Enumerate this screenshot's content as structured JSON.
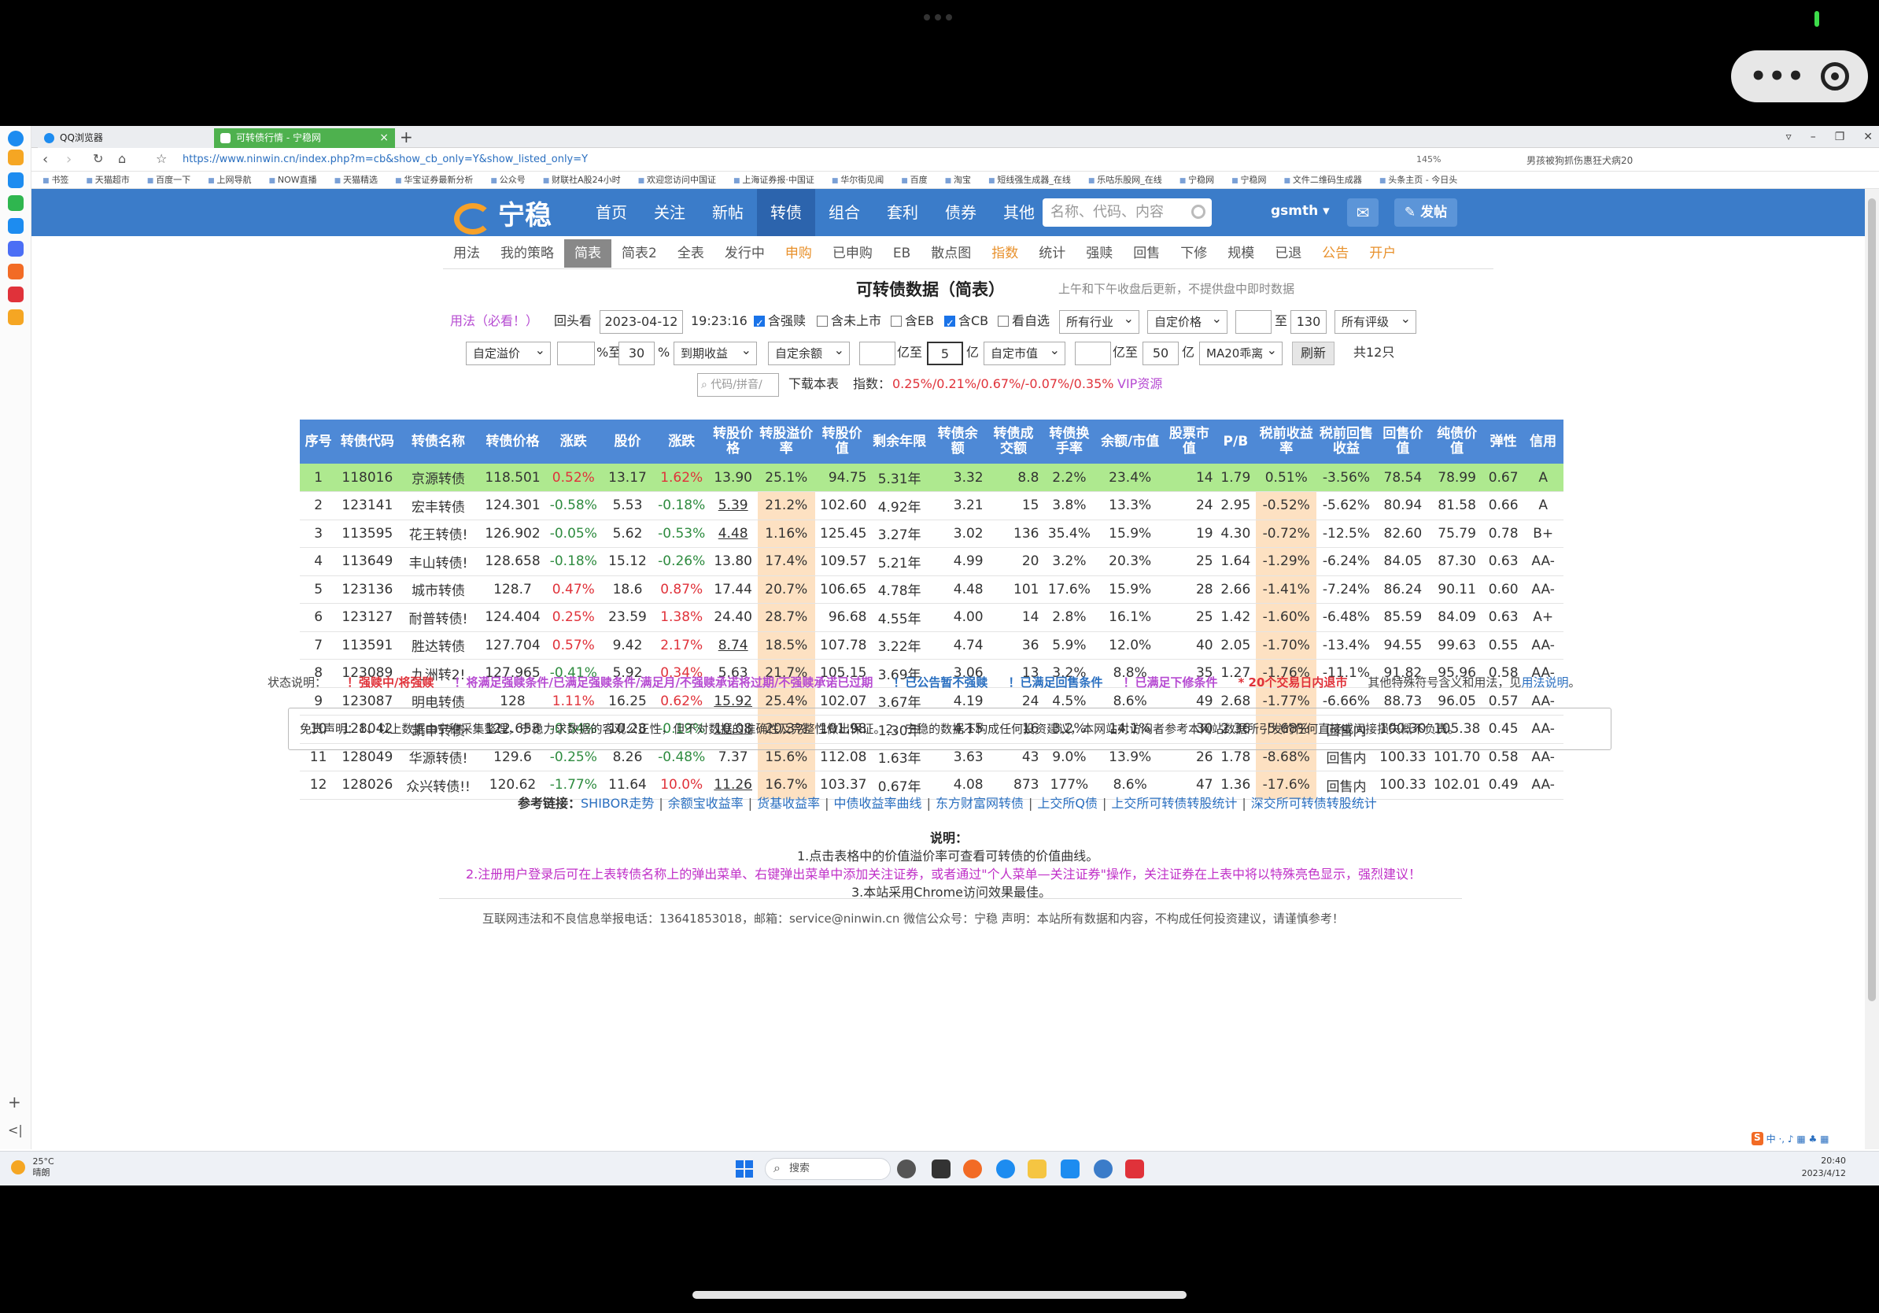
{
  "browser": {
    "tabs": [
      {
        "label": "QQ浏览器"
      },
      {
        "label": "可转债行情 - 宁稳网"
      }
    ],
    "url": "https://www.ninwin.cn/index.php?m=cb&show_cb_only=Y&show_listed_only=Y",
    "zoom": "145%",
    "notification": "男孩被狗抓伤惠狂犬病20",
    "bookmarks": [
      "书签",
      "天猫超市",
      "百度一下",
      "上网导航",
      "NOW直播",
      "天猫精选",
      "华宝证券最新分析",
      "公众号",
      "财联社A股24小时",
      "欢迎您访问中国证",
      "上海证券报·中国证",
      "华尔街见闻",
      "百度",
      "淘宝",
      "短线强生成器_在线",
      "乐咕乐股网_在线",
      "宁稳网",
      "宁稳网",
      "文件二维码生成器",
      "头条主页 - 今日头"
    ]
  },
  "site": {
    "logo": "宁稳",
    "nav": [
      "首页",
      "关注",
      "新帖",
      "转债",
      "组合",
      "套利",
      "债券",
      "其他"
    ],
    "nav_active": "转债",
    "search_placeholder": "名称、代码、内容",
    "user": "gsmth",
    "post_label": "发帖",
    "subnav": [
      "用法",
      "我的策略",
      "简表",
      "简表2",
      "全表",
      "发行中",
      "申购",
      "已申购",
      "EB",
      "散点图",
      "指数",
      "统计",
      "强赎",
      "回售",
      "下修",
      "规模",
      "已退",
      "公告",
      "开户"
    ],
    "subnav_active": "简表"
  },
  "page": {
    "title": "可转债数据（简表）",
    "title_note": "上午和下午收盘后更新，不提供盘中即时数据",
    "filters": {
      "usage_link": "用法（必看！）",
      "lookback_label": "回头看",
      "date": "2023-04-12",
      "time": "19:23:16",
      "cb_strong": "含强赎",
      "cb_unlisted": "含未上市",
      "cb_eb": "含EB",
      "cb_cb": "含CB",
      "cb_watch": "看自选",
      "industry": "所有行业",
      "price_sel": "自定价格",
      "price_to_label": "至",
      "price_max": "130",
      "rating": "所有评级",
      "premium_sel": "自定溢价",
      "premium_to_label": "%至",
      "premium_max": "30",
      "premium_unit": "%",
      "yield_sel": "到期收益",
      "balance_sel": "自定余额",
      "balance_to_label": "亿至",
      "balance_max": "5",
      "balance_unit": "亿",
      "mktcap_sel": "自定市值",
      "mktcap_to_label": "亿至",
      "mktcap_max": "50",
      "mktcap_unit": "亿",
      "ma_sel": "MA20乖离",
      "refresh": "刷新",
      "count": "共12只",
      "code_placeholder": "代码/拼音/",
      "download": "下载本表",
      "index_label": "指数：",
      "index_values": "0.25%/0.21%/0.67%/-0.07%/0.35%",
      "vip": "VIP资源"
    },
    "table": {
      "headers": [
        "序号",
        "转债代码",
        "转债名称",
        "转债价格",
        "涨跌",
        "股价",
        "涨跌",
        "转股价格",
        "转股溢价率",
        "转股价值",
        "剩余年限",
        "转债余额",
        "转债成交额",
        "转债换手率",
        "余额/市值",
        "股票市值",
        "P/B",
        "税前收益率",
        "税前回售收益",
        "回售价值",
        "纯债价值",
        "弹性",
        "信用"
      ],
      "rows": [
        [
          "1",
          "118016",
          "京源转债",
          "118.501",
          "0.52%",
          "13.17",
          "1.62%",
          "13.90",
          "25.1%",
          "94.75",
          "5.31年",
          "3.32",
          "8.8",
          "2.2%",
          "23.4%",
          "14",
          "1.79",
          "0.51%",
          "-3.56%",
          "78.54",
          "78.99",
          "0.67",
          "A"
        ],
        [
          "2",
          "123141",
          "宏丰转债",
          "124.301",
          "-0.58%",
          "5.53",
          "-0.18%",
          "5.39",
          "21.2%",
          "102.60",
          "4.92年",
          "3.21",
          "15",
          "3.8%",
          "13.3%",
          "24",
          "2.95",
          "-0.52%",
          "-5.62%",
          "80.94",
          "81.58",
          "0.66",
          "A"
        ],
        [
          "3",
          "113595",
          "花王转债!",
          "126.902",
          "-0.05%",
          "5.62",
          "-0.53%",
          "4.48",
          "1.16%",
          "125.45",
          "3.27年",
          "3.02",
          "136",
          "35.4%",
          "15.9%",
          "19",
          "4.30",
          "-0.72%",
          "-12.5%",
          "82.60",
          "75.79",
          "0.78",
          "B+"
        ],
        [
          "4",
          "113649",
          "丰山转债!",
          "128.658",
          "-0.18%",
          "15.12",
          "-0.26%",
          "13.80",
          "17.4%",
          "109.57",
          "5.21年",
          "4.99",
          "20",
          "3.2%",
          "20.3%",
          "25",
          "1.64",
          "-1.29%",
          "-6.24%",
          "84.05",
          "87.30",
          "0.63",
          "AA-"
        ],
        [
          "5",
          "123136",
          "城市转债",
          "128.7",
          "0.47%",
          "18.6",
          "0.87%",
          "17.44",
          "20.7%",
          "106.65",
          "4.78年",
          "4.48",
          "101",
          "17.6%",
          "15.9%",
          "28",
          "2.66",
          "-1.41%",
          "-7.24%",
          "86.24",
          "90.11",
          "0.60",
          "AA-"
        ],
        [
          "6",
          "123127",
          "耐普转债!",
          "124.404",
          "0.25%",
          "23.59",
          "1.38%",
          "24.40",
          "28.7%",
          "96.68",
          "4.55年",
          "4.00",
          "14",
          "2.8%",
          "16.1%",
          "25",
          "1.42",
          "-1.60%",
          "-6.48%",
          "85.59",
          "84.09",
          "0.63",
          "A+"
        ],
        [
          "7",
          "113591",
          "胜达转债",
          "127.704",
          "0.57%",
          "9.42",
          "2.17%",
          "8.74",
          "18.5%",
          "107.78",
          "3.22年",
          "4.74",
          "36",
          "5.9%",
          "12.0%",
          "40",
          "2.05",
          "-1.70%",
          "-13.4%",
          "94.55",
          "99.63",
          "0.55",
          "AA-"
        ],
        [
          "8",
          "123089",
          "九洲转2!",
          "127.965",
          "-0.41%",
          "5.92",
          "0.34%",
          "5.63",
          "21.7%",
          "105.15",
          "3.69年",
          "3.06",
          "13",
          "3.2%",
          "8.8%",
          "35",
          "1.27",
          "-1.76%",
          "-11.1%",
          "91.82",
          "95.96",
          "0.58",
          "AA-"
        ],
        [
          "9",
          "123087",
          "明电转债",
          "128",
          "1.11%",
          "16.25",
          "0.62%",
          "15.92",
          "25.4%",
          "102.07",
          "3.67年",
          "4.19",
          "24",
          "4.5%",
          "8.6%",
          "49",
          "2.68",
          "-1.77%",
          "-6.66%",
          "88.73",
          "96.05",
          "0.57",
          "AA-"
        ],
        [
          "10",
          "128042",
          "凯中转债",
          "122.653",
          "-0.54%",
          "10.28",
          "-0.19%",
          "10.08",
          "20.3%",
          "101.98",
          "1.30年",
          "4.15",
          "16",
          "3.2%",
          "14.1%",
          "30",
          "2.36",
          "-5.68%",
          "回售内",
          "100.30",
          "105.38",
          "0.45",
          "AA-"
        ],
        [
          "11",
          "128049",
          "华源转债!",
          "129.6",
          "-0.25%",
          "8.26",
          "-0.48%",
          "7.37",
          "15.6%",
          "112.08",
          "1.63年",
          "3.63",
          "43",
          "9.0%",
          "13.9%",
          "26",
          "1.78",
          "-8.68%",
          "回售内",
          "100.33",
          "101.70",
          "0.58",
          "AA-"
        ],
        [
          "12",
          "128026",
          "众兴转债!!",
          "120.62",
          "-1.77%",
          "11.64",
          "10.0%",
          "11.26",
          "16.7%",
          "103.37",
          "0.67年",
          "4.08",
          "873",
          "177%",
          "8.6%",
          "47",
          "1.36",
          "-17.6%",
          "回售内",
          "100.33",
          "102.01",
          "0.49",
          "AA-"
        ]
      ]
    },
    "legend": [
      "状态说明：",
      "！强赎中/将强赎",
      "！将满足强赎条件/已满足强赎条件/满足月/不强赎承诺将过期/不强赎承诺已过期",
      "！已公告暂不强赎",
      "！已满足回售条件",
      "！已满足下修条件",
      "* 20个交易日内退市",
      "其他特殊符号含义和用法，见",
      "用法说明",
      "。"
    ],
    "disclaimer": "免责声明：1、以上数据由宁稳采集整理，宁稳力求数据的客观公正性，但不对数据的准确性及完整性做出保证。2、宁稳的数据不构成任何投资建议，本网站对访问者参考本网站数据所引发的任何直接或间接损失概不负责。",
    "refs_label": "参考链接：",
    "refs": [
      "SHIBOR走势",
      "余额宝收益率",
      "货基收益率",
      "中债收益率曲线",
      "东方财富网转债",
      "上交所Q债",
      "上交所可转债转股统计",
      "深交所可转债转股统计"
    ],
    "notes_title": "说明：",
    "notes": [
      "1.点击表格中的价值溢价率可查看可转债的价值曲线。",
      "2.注册用户登录后可在上表转债名称上的弹出菜单、右键弹出菜单中添加关注证券，或者通过\"个人菜单—关注证券\"操作，关注证券在上表中将以特殊亮色显示，强烈建议！",
      "3.本站采用Chrome访问效果最佳。"
    ],
    "footer": "互联网违法和不良信息举报电话：13641853018，邮箱：service@ninwin.cn     微信公众号：宁稳     声明：本站所有数据和内容，不构成任何投资建议，请谨慎参考！"
  },
  "taskbar": {
    "weather_temp": "25°C",
    "weather_desc": "晴朗",
    "search": "搜索",
    "time": "20:40",
    "date": "2023/4/12"
  },
  "colors": {
    "nav": "#3b7cc9",
    "header": "#4e89d6",
    "highlight_row": "#aee98f",
    "premium_col": "#fde1c2",
    "up": "#e0323a",
    "down": "#2e8b3f"
  }
}
